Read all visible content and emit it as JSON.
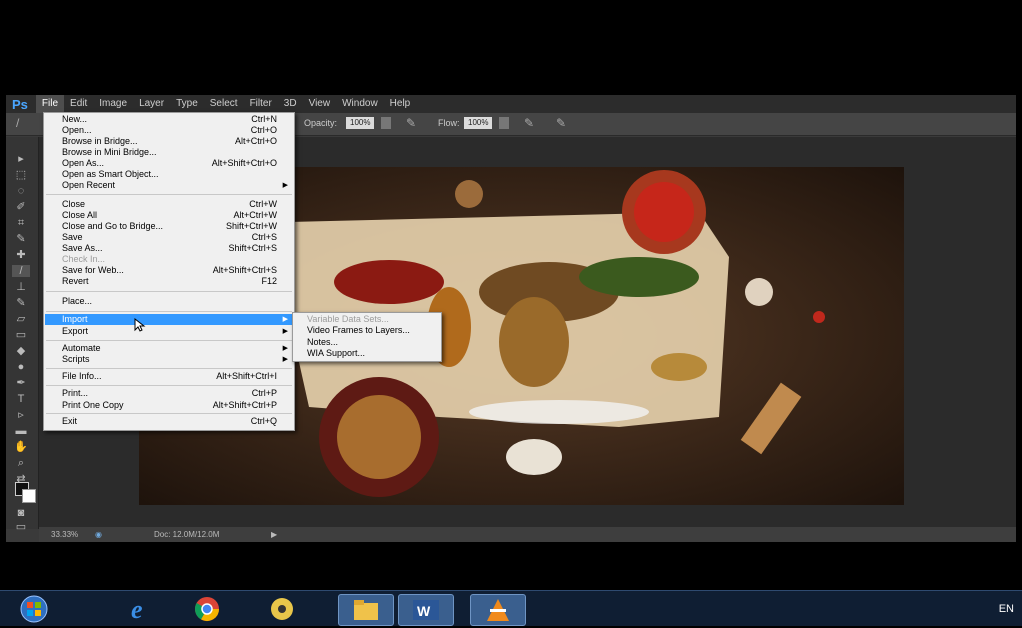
{
  "app": {
    "logo": "Ps",
    "menus": [
      "File",
      "Edit",
      "Image",
      "Layer",
      "Type",
      "Select",
      "Filter",
      "3D",
      "View",
      "Window",
      "Help"
    ]
  },
  "options_bar": {
    "opacity_label": "Opacity:",
    "opacity_value": "100%",
    "flow_label": "Flow:",
    "flow_value": "100%"
  },
  "status_bar": {
    "zoom": "33.33%",
    "doc": "Doc: 12.0M/12.0M"
  },
  "file_menu": {
    "items": [
      {
        "label": "New...",
        "shortcut": "Ctrl+N"
      },
      {
        "label": "Open...",
        "shortcut": "Ctrl+O"
      },
      {
        "label": "Browse in Bridge...",
        "shortcut": "Alt+Ctrl+O"
      },
      {
        "label": "Browse in Mini Bridge...",
        "shortcut": ""
      },
      {
        "label": "Open As...",
        "shortcut": "Alt+Shift+Ctrl+O"
      },
      {
        "label": "Open as Smart Object...",
        "shortcut": ""
      },
      {
        "label": "Open Recent",
        "shortcut": ""
      },
      {
        "label": "Close",
        "shortcut": "Ctrl+W"
      },
      {
        "label": "Close All",
        "shortcut": "Alt+Ctrl+W"
      },
      {
        "label": "Close and Go to Bridge...",
        "shortcut": "Shift+Ctrl+W"
      },
      {
        "label": "Save",
        "shortcut": "Ctrl+S"
      },
      {
        "label": "Save As...",
        "shortcut": "Shift+Ctrl+S"
      },
      {
        "label": "Check In...",
        "shortcut": ""
      },
      {
        "label": "Save for Web...",
        "shortcut": "Alt+Shift+Ctrl+S"
      },
      {
        "label": "Revert",
        "shortcut": "F12"
      },
      {
        "label": "Place...",
        "shortcut": ""
      },
      {
        "label": "Import",
        "shortcut": ""
      },
      {
        "label": "Export",
        "shortcut": ""
      },
      {
        "label": "Automate",
        "shortcut": ""
      },
      {
        "label": "Scripts",
        "shortcut": ""
      },
      {
        "label": "File Info...",
        "shortcut": "Alt+Shift+Ctrl+I"
      },
      {
        "label": "Print...",
        "shortcut": "Ctrl+P"
      },
      {
        "label": "Print One Copy",
        "shortcut": "Alt+Shift+Ctrl+P"
      },
      {
        "label": "Exit",
        "shortcut": "Ctrl+Q"
      }
    ]
  },
  "import_submenu": {
    "items": [
      "Variable Data Sets...",
      "Video Frames to Layers...",
      "Notes...",
      "WIA Support..."
    ]
  },
  "taskbar": {
    "language": "EN",
    "icons": [
      "start-orb-icon",
      "internet-explorer-icon",
      "chrome-icon",
      "media-player-icon",
      "file-explorer-icon",
      "word-icon",
      "vlc-icon"
    ]
  },
  "colors": {
    "highlight": "#3399ff",
    "ps_blue": "#4aa6ff"
  }
}
